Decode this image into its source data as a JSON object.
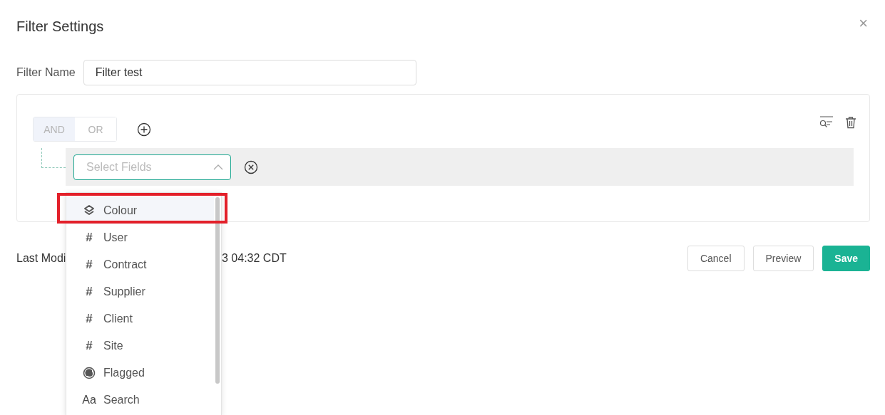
{
  "dialog": {
    "title": "Filter Settings",
    "close": "×"
  },
  "filter_name": {
    "label": "Filter Name",
    "value": "Filter test"
  },
  "logic": [
    {
      "label": "AND",
      "selected": true
    },
    {
      "label": "OR",
      "selected": false
    }
  ],
  "condition": {
    "field": {
      "placeholder": "Select Fields",
      "expanded": true
    }
  },
  "field_options": [
    {
      "kind": "layers",
      "label": "Colour",
      "selected": true,
      "annotated": true
    },
    {
      "kind": "glyph",
      "glyph": "#",
      "label": "User",
      "selected": false,
      "annotated": false
    },
    {
      "kind": "glyph",
      "glyph": "#",
      "label": "Contract",
      "selected": false,
      "annotated": false
    },
    {
      "kind": "glyph",
      "glyph": "#",
      "label": "Supplier",
      "selected": false,
      "annotated": false
    },
    {
      "kind": "glyph",
      "glyph": "#",
      "label": "Client",
      "selected": false,
      "annotated": false
    },
    {
      "kind": "glyph",
      "glyph": "#",
      "label": "Site",
      "selected": false,
      "annotated": false
    },
    {
      "kind": "flag",
      "label": "Flagged",
      "selected": false,
      "annotated": false
    },
    {
      "kind": "glyph",
      "glyph": "Aa",
      "label": "Search",
      "selected": false,
      "annotated": false
    }
  ],
  "footer": {
    "modified_start": "Last Modi",
    "modified_end": "3 04:32 CDT",
    "buttons": [
      {
        "kind": "plain",
        "label": "Cancel"
      },
      {
        "kind": "plain",
        "label": "Preview"
      },
      {
        "kind": "primary",
        "label": "Save"
      }
    ]
  }
}
